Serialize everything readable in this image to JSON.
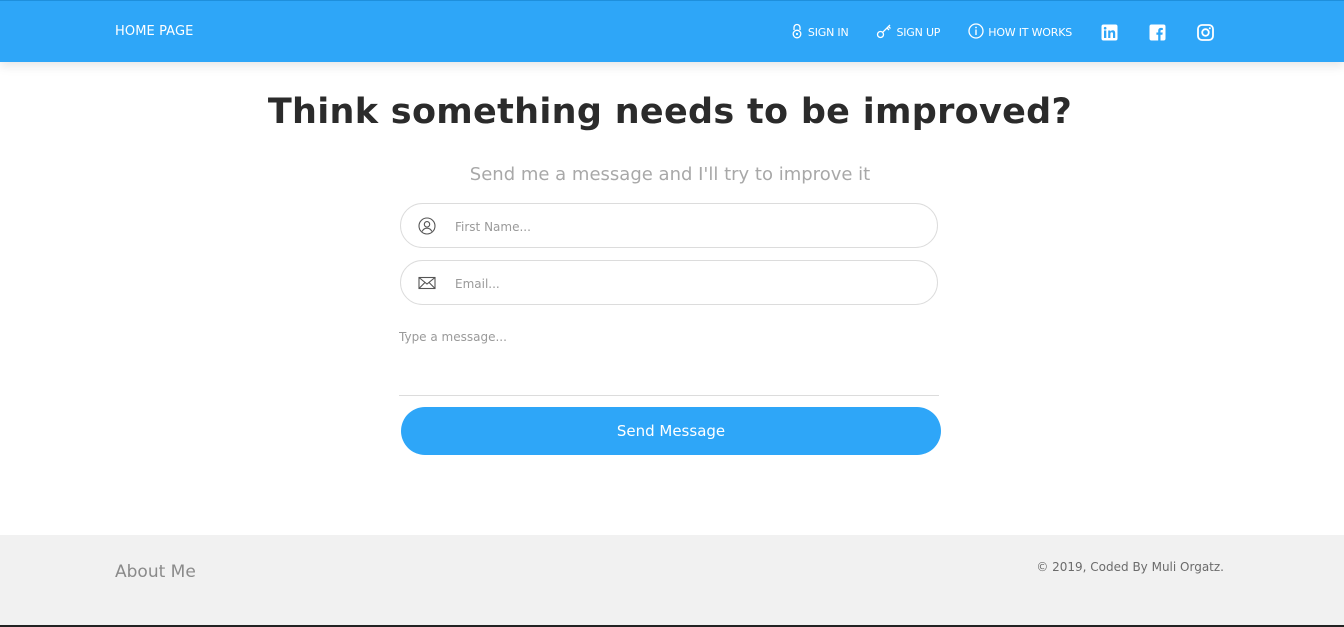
{
  "nav": {
    "brand": "HOME PAGE",
    "links": [
      {
        "label": "SIGN IN",
        "icon": "lock-icon"
      },
      {
        "label": "SIGN UP",
        "icon": "key-icon"
      },
      {
        "label": "HOW IT WORKS",
        "icon": "info-icon"
      }
    ],
    "social": [
      "linkedin-icon",
      "facebook-icon",
      "instagram-icon"
    ]
  },
  "main": {
    "heading": "Think something needs to be improved?",
    "subheading": "Send me a message and I'll try to improve it",
    "first_name_placeholder": "First Name...",
    "email_placeholder": "Email...",
    "message_placeholder": "Type a message...",
    "send_label": "Send Message"
  },
  "footer": {
    "about": "About Me",
    "copyright": "© 2019, Coded By Muli Orgatz."
  },
  "colors": {
    "accent": "#2ea6f8",
    "heading": "#2b2b2b",
    "footer_bg": "#f1f1f1"
  }
}
